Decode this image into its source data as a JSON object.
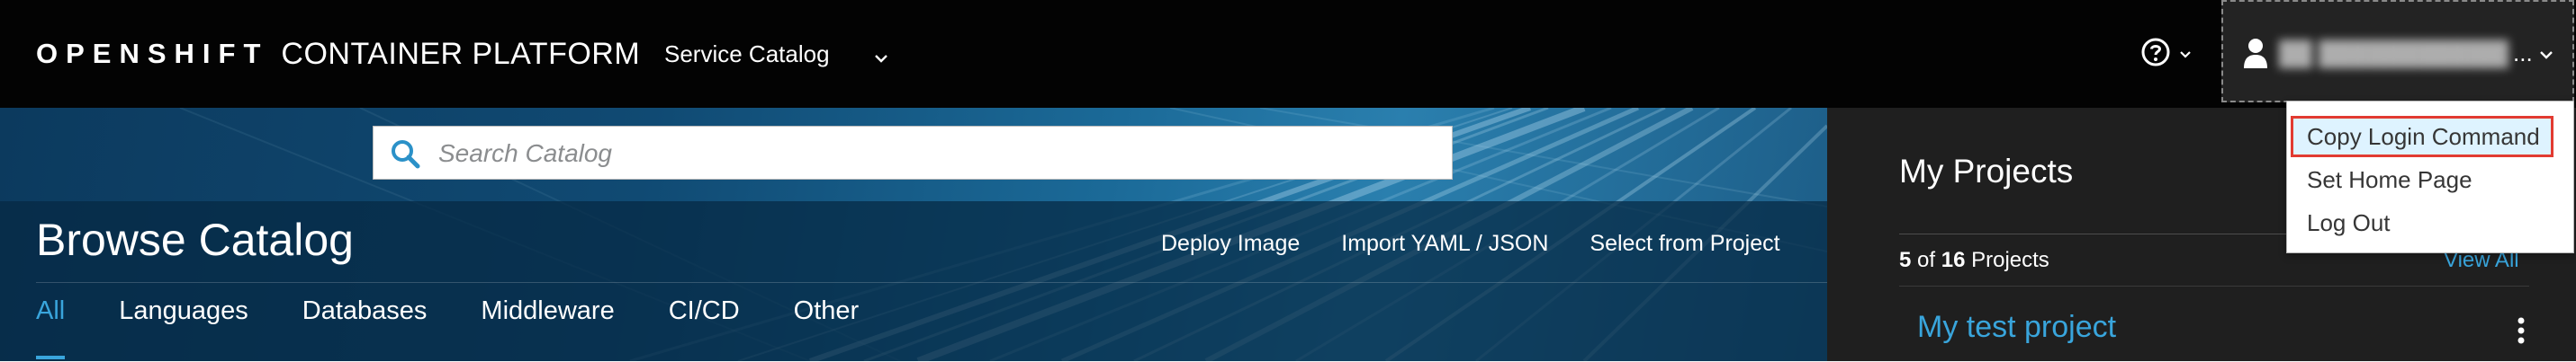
{
  "header": {
    "brand_bold": "OPENSHIFT",
    "brand_light": "CONTAINER PLATFORM",
    "context_selector": "Service Catalog",
    "user_name": "██ ████████████ ████████",
    "user_ellipsis": "..."
  },
  "hero": {
    "search_placeholder": "Search Catalog",
    "title": "Browse Catalog",
    "actions": [
      "Deploy Image",
      "Import YAML / JSON",
      "Select from Project"
    ],
    "tabs": [
      "All",
      "Languages",
      "Databases",
      "Middleware",
      "CI/CD",
      "Other"
    ],
    "active_tab": "All"
  },
  "projects": {
    "title": "My Projects",
    "count_shown": "5",
    "count_of": "of",
    "count_total": "16",
    "count_label": "Projects",
    "view_all": "View All",
    "items": [
      "My test project"
    ]
  },
  "user_menu": {
    "items": [
      "Copy Login Command",
      "Set Home Page",
      "Log Out"
    ],
    "highlighted_item": "Copy Login Command"
  },
  "colors": {
    "topbar_bg": "#030303",
    "accent_blue": "#39a5dc",
    "highlight_border": "#e23b31",
    "menu_highlight_bg": "#def3ff",
    "projects_bg": "#1f1f1f"
  },
  "icons": {
    "context_chevron": "chevron-down-icon",
    "help": "question-circle-icon",
    "user": "user-icon",
    "search": "search-icon",
    "kebab": "kebab-icon"
  }
}
